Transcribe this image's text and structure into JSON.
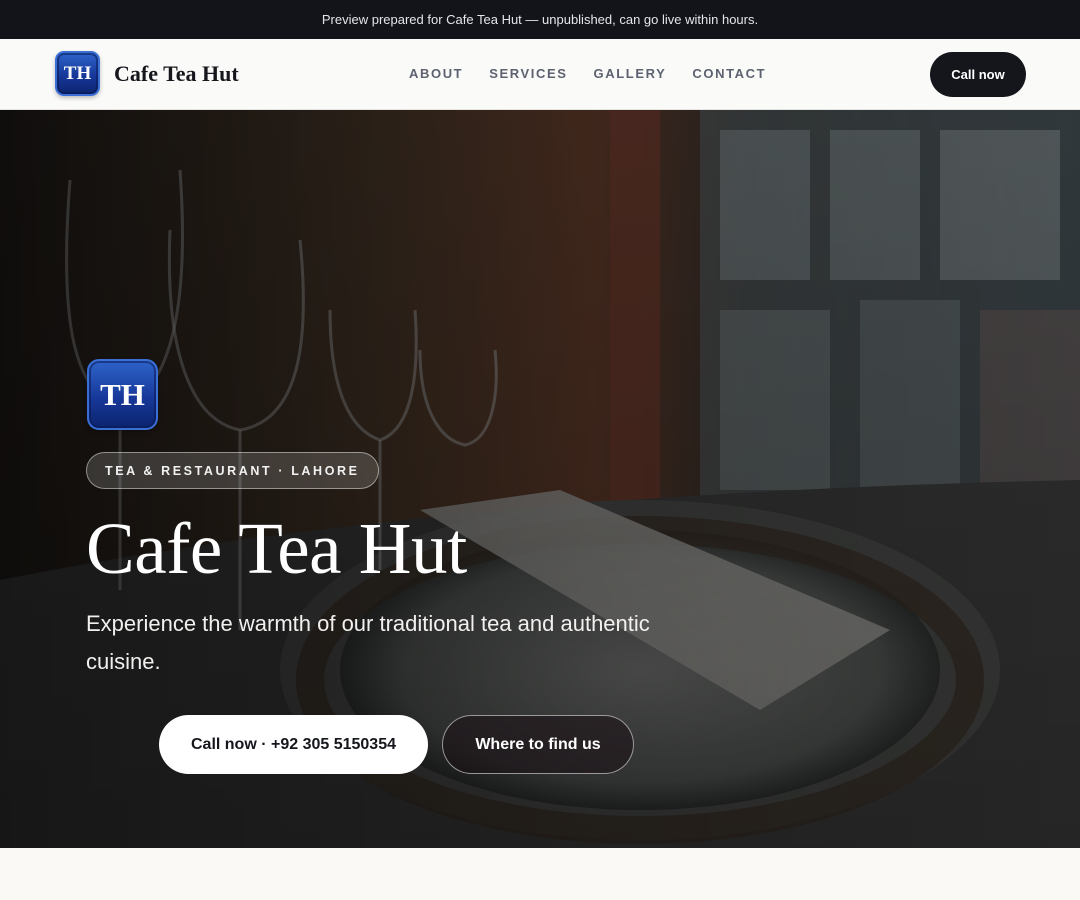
{
  "preview_bar": {
    "text": "Preview prepared for Cafe Tea Hut — unpublished, can go live within hours."
  },
  "header": {
    "logo_text": "TH",
    "brand_name": "Cafe Tea Hut",
    "nav": [
      "ABOUT",
      "SERVICES",
      "GALLERY",
      "CONTACT"
    ],
    "call_label": "Call now"
  },
  "hero": {
    "logo_text": "TH",
    "tagline": "TEA & RESTAURANT · LAHORE",
    "title": "Cafe Tea Hut",
    "subtitle": "Experience the warmth of our traditional tea and authentic cuisine.",
    "call_button": "Call now · +92 305 5150354",
    "find_button": "Where to find us"
  },
  "colors": {
    "dark": "#14161b",
    "logo_blue": "#17389a",
    "page_bg": "#faf9f6"
  }
}
